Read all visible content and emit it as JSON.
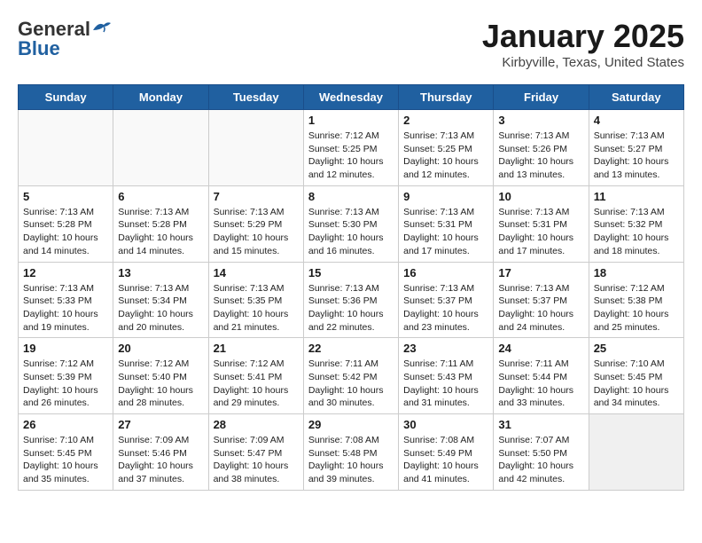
{
  "header": {
    "logo_general": "General",
    "logo_blue": "Blue",
    "month_title": "January 2025",
    "location": "Kirbyville, Texas, United States"
  },
  "weekdays": [
    "Sunday",
    "Monday",
    "Tuesday",
    "Wednesday",
    "Thursday",
    "Friday",
    "Saturday"
  ],
  "weeks": [
    [
      {
        "day": "",
        "info": ""
      },
      {
        "day": "",
        "info": ""
      },
      {
        "day": "",
        "info": ""
      },
      {
        "day": "1",
        "info": "Sunrise: 7:12 AM\nSunset: 5:25 PM\nDaylight: 10 hours\nand 12 minutes."
      },
      {
        "day": "2",
        "info": "Sunrise: 7:13 AM\nSunset: 5:25 PM\nDaylight: 10 hours\nand 12 minutes."
      },
      {
        "day": "3",
        "info": "Sunrise: 7:13 AM\nSunset: 5:26 PM\nDaylight: 10 hours\nand 13 minutes."
      },
      {
        "day": "4",
        "info": "Sunrise: 7:13 AM\nSunset: 5:27 PM\nDaylight: 10 hours\nand 13 minutes."
      }
    ],
    [
      {
        "day": "5",
        "info": "Sunrise: 7:13 AM\nSunset: 5:28 PM\nDaylight: 10 hours\nand 14 minutes."
      },
      {
        "day": "6",
        "info": "Sunrise: 7:13 AM\nSunset: 5:28 PM\nDaylight: 10 hours\nand 14 minutes."
      },
      {
        "day": "7",
        "info": "Sunrise: 7:13 AM\nSunset: 5:29 PM\nDaylight: 10 hours\nand 15 minutes."
      },
      {
        "day": "8",
        "info": "Sunrise: 7:13 AM\nSunset: 5:30 PM\nDaylight: 10 hours\nand 16 minutes."
      },
      {
        "day": "9",
        "info": "Sunrise: 7:13 AM\nSunset: 5:31 PM\nDaylight: 10 hours\nand 17 minutes."
      },
      {
        "day": "10",
        "info": "Sunrise: 7:13 AM\nSunset: 5:31 PM\nDaylight: 10 hours\nand 17 minutes."
      },
      {
        "day": "11",
        "info": "Sunrise: 7:13 AM\nSunset: 5:32 PM\nDaylight: 10 hours\nand 18 minutes."
      }
    ],
    [
      {
        "day": "12",
        "info": "Sunrise: 7:13 AM\nSunset: 5:33 PM\nDaylight: 10 hours\nand 19 minutes."
      },
      {
        "day": "13",
        "info": "Sunrise: 7:13 AM\nSunset: 5:34 PM\nDaylight: 10 hours\nand 20 minutes."
      },
      {
        "day": "14",
        "info": "Sunrise: 7:13 AM\nSunset: 5:35 PM\nDaylight: 10 hours\nand 21 minutes."
      },
      {
        "day": "15",
        "info": "Sunrise: 7:13 AM\nSunset: 5:36 PM\nDaylight: 10 hours\nand 22 minutes."
      },
      {
        "day": "16",
        "info": "Sunrise: 7:13 AM\nSunset: 5:37 PM\nDaylight: 10 hours\nand 23 minutes."
      },
      {
        "day": "17",
        "info": "Sunrise: 7:13 AM\nSunset: 5:37 PM\nDaylight: 10 hours\nand 24 minutes."
      },
      {
        "day": "18",
        "info": "Sunrise: 7:12 AM\nSunset: 5:38 PM\nDaylight: 10 hours\nand 25 minutes."
      }
    ],
    [
      {
        "day": "19",
        "info": "Sunrise: 7:12 AM\nSunset: 5:39 PM\nDaylight: 10 hours\nand 26 minutes."
      },
      {
        "day": "20",
        "info": "Sunrise: 7:12 AM\nSunset: 5:40 PM\nDaylight: 10 hours\nand 28 minutes."
      },
      {
        "day": "21",
        "info": "Sunrise: 7:12 AM\nSunset: 5:41 PM\nDaylight: 10 hours\nand 29 minutes."
      },
      {
        "day": "22",
        "info": "Sunrise: 7:11 AM\nSunset: 5:42 PM\nDaylight: 10 hours\nand 30 minutes."
      },
      {
        "day": "23",
        "info": "Sunrise: 7:11 AM\nSunset: 5:43 PM\nDaylight: 10 hours\nand 31 minutes."
      },
      {
        "day": "24",
        "info": "Sunrise: 7:11 AM\nSunset: 5:44 PM\nDaylight: 10 hours\nand 33 minutes."
      },
      {
        "day": "25",
        "info": "Sunrise: 7:10 AM\nSunset: 5:45 PM\nDaylight: 10 hours\nand 34 minutes."
      }
    ],
    [
      {
        "day": "26",
        "info": "Sunrise: 7:10 AM\nSunset: 5:45 PM\nDaylight: 10 hours\nand 35 minutes."
      },
      {
        "day": "27",
        "info": "Sunrise: 7:09 AM\nSunset: 5:46 PM\nDaylight: 10 hours\nand 37 minutes."
      },
      {
        "day": "28",
        "info": "Sunrise: 7:09 AM\nSunset: 5:47 PM\nDaylight: 10 hours\nand 38 minutes."
      },
      {
        "day": "29",
        "info": "Sunrise: 7:08 AM\nSunset: 5:48 PM\nDaylight: 10 hours\nand 39 minutes."
      },
      {
        "day": "30",
        "info": "Sunrise: 7:08 AM\nSunset: 5:49 PM\nDaylight: 10 hours\nand 41 minutes."
      },
      {
        "day": "31",
        "info": "Sunrise: 7:07 AM\nSunset: 5:50 PM\nDaylight: 10 hours\nand 42 minutes."
      },
      {
        "day": "",
        "info": ""
      }
    ]
  ]
}
